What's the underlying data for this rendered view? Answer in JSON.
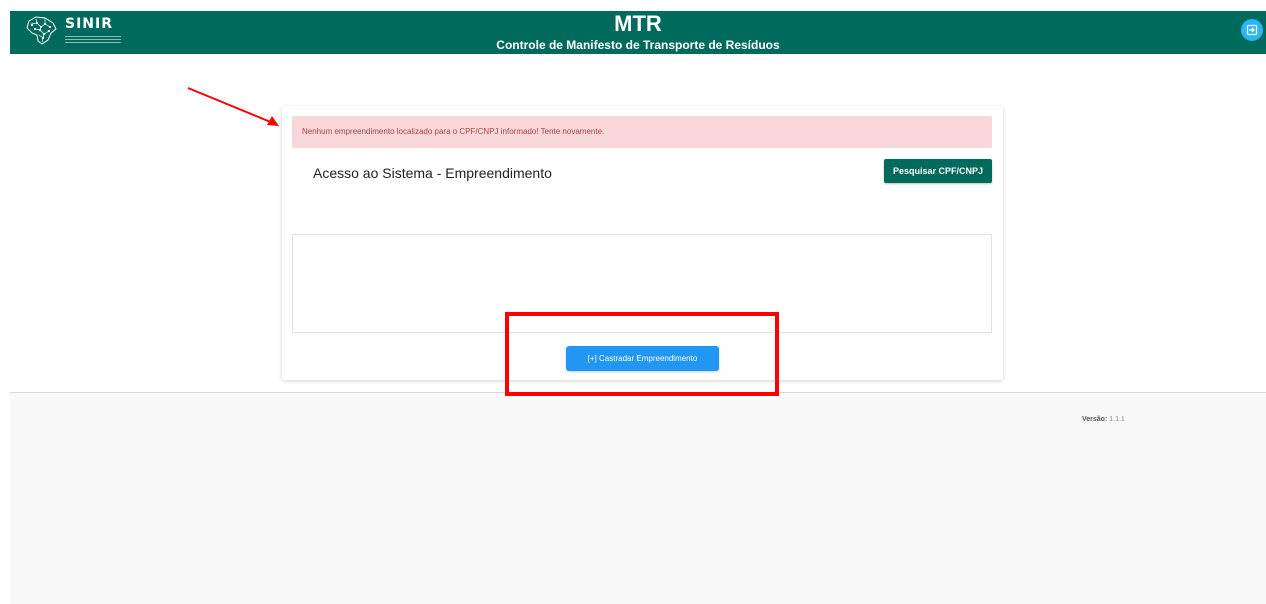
{
  "header": {
    "logo_text": "SINIR",
    "title": "MTR",
    "subtitle": "Controle de Manifesto de Transporte de Resíduos",
    "logout_icon": "logout-icon",
    "bg_color": "#006a5c"
  },
  "card": {
    "alert_message": "Nenhum empreendimento localizado para o CPF/CNPJ informado! Tente novamente.",
    "title": "Acesso ao Sistema - Empreendimento",
    "search_button": "Pesquisar CPF/CNPJ",
    "register_button": "[+] Castradar Empreendimento"
  },
  "footer": {
    "version_label": "Versão:",
    "version_value": "1.1.1"
  },
  "annotations": {
    "color": "#ff0000"
  }
}
